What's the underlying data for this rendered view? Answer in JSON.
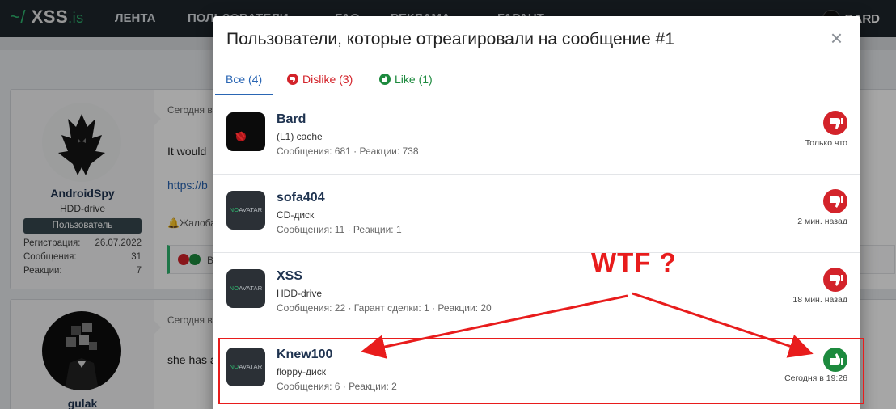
{
  "site": {
    "logo": "XSS",
    "logo_tld": ".is",
    "nav": [
      "ЛЕНТА",
      "ПОЛЬЗОВАТЕЛИ",
      "FAQ",
      "РЕКЛАМА",
      "ГАРАНТ"
    ],
    "current_user": "BARD"
  },
  "posts": [
    {
      "author": "AndroidSpy",
      "title": "HDD-drive",
      "badge": "Пользователь",
      "stats": [
        {
          "label": "Регистрация:",
          "value": "26.07.2022"
        },
        {
          "label": "Сообщения:",
          "value": "31"
        },
        {
          "label": "Реакции:",
          "value": "7"
        }
      ],
      "date": "Сегодня в",
      "text": "It would",
      "link": "https://b",
      "report": "Жалоба",
      "reactions_text": "Вы"
    },
    {
      "author": "gulak",
      "date": "Сегодня в",
      "text": "she has a"
    }
  ],
  "modal": {
    "title": "Пользователи, которые отреагировали на сообщение #1",
    "close": "×",
    "tabs": {
      "all": "Все (4)",
      "dislike": "Dislike (3)",
      "like": "Like (1)"
    },
    "users": [
      {
        "name": "Bard",
        "title": "(L1) cache",
        "stats": "Сообщения: 681 · Реакции: 738",
        "reaction": "dislike",
        "time": "Только что",
        "avatar": "custom"
      },
      {
        "name": "sofa404",
        "title": "CD-диск",
        "stats": "Сообщения: 11 · Реакции: 1",
        "reaction": "dislike",
        "time": "2 мин. назад",
        "avatar": "no-avatar"
      },
      {
        "name": "XSS",
        "title": "HDD-drive",
        "stats": "Сообщения: 22 · Гарант сделки: 1 · Реакции: 20",
        "reaction": "dislike",
        "time": "18 мин. назад",
        "avatar": "no-avatar"
      },
      {
        "name": "Knew100",
        "title": "floppy-диск",
        "stats": "Сообщения: 6 · Реакции: 2",
        "reaction": "like",
        "time": "Сегодня в 19:26",
        "avatar": "no-avatar"
      }
    ],
    "no_avatar": {
      "no": "NO",
      "avatar": "AVATAR"
    }
  },
  "annotation": {
    "text": "WTF ?",
    "color": "#e81c1c"
  },
  "colors": {
    "dislike": "#d3232a",
    "like": "#1d8a3e",
    "accent": "#2a66b4"
  },
  "icons": {
    "dislike": "thumbs-down-icon",
    "like": "thumbs-up-icon",
    "close": "close-icon"
  }
}
